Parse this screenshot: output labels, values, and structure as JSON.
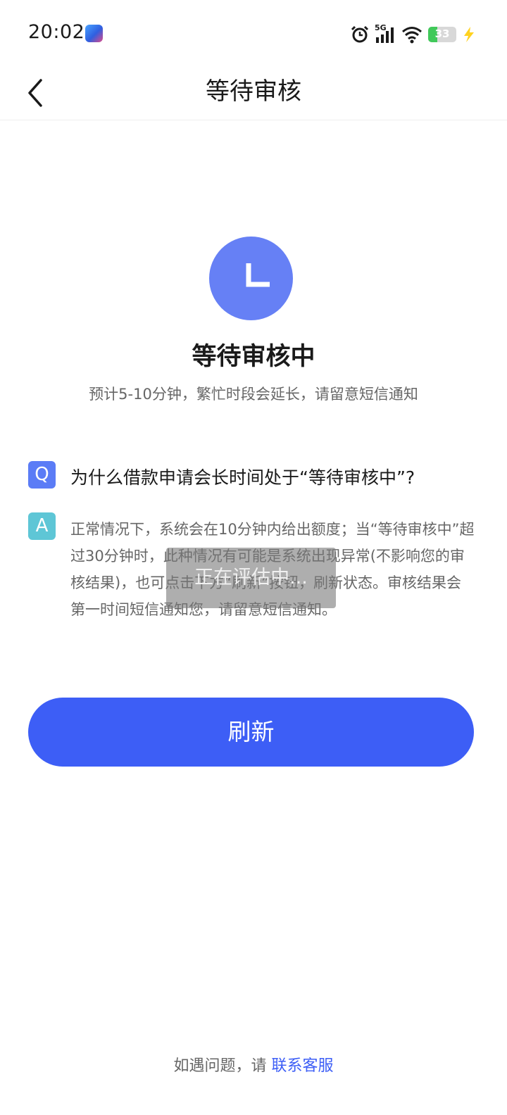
{
  "status_bar": {
    "time": "20:02",
    "network": "5G",
    "battery_level": "33",
    "battery_fraction": 0.33
  },
  "header": {
    "title": "等待审核"
  },
  "status": {
    "title": "等待审核中",
    "subtitle": "预计5-10分钟，繁忙时段会延长，请留意短信通知"
  },
  "faq": {
    "q_badge": "Q",
    "question": "为什么借款申请会长时间处于“等待审核中”?",
    "a_badge": "A",
    "answer": "正常情况下，系统会在10分钟内给出额度；当“等待审核中”超过30分钟时，此种情况有可能是系统出现异常(不影响您的审核结果)，也可点击下方“刷新”按钮，刷新状态。审核结果会第一时间短信通知您，请留意短信通知。"
  },
  "toast": {
    "text": "正在评估中..."
  },
  "actions": {
    "refresh_label": "刷新"
  },
  "footer": {
    "prefix": "如遇问题，请",
    "link_label": "联系客服"
  },
  "colors": {
    "accent": "#3d5ef6",
    "clock_bg": "#6680f5",
    "q_badge": "#5b7cf6",
    "a_badge": "#5ec6d6",
    "battery_fill": "#41c95a",
    "charging": "#ffd21f"
  },
  "icons": {
    "back": "chevron-left-icon",
    "clock": "clock-icon",
    "alarm": "alarm-icon",
    "signal": "signal-icon",
    "wifi": "wifi-icon",
    "battery": "battery-icon",
    "charging": "charging-bolt-icon"
  }
}
